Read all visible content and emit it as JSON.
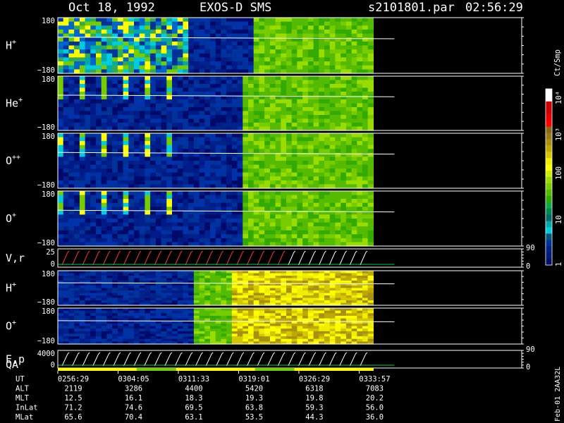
{
  "header": {
    "date": "Oct 18, 1992",
    "instrument": "EXOS-D SMS",
    "file": "s2101801.par",
    "time": "02:56:29"
  },
  "colorbar": {
    "unit": "Ct/Smp",
    "labels": [
      "10⁴",
      "10³",
      "100",
      "10",
      "1"
    ],
    "colors": [
      "#ffffff",
      "#ffffff",
      "#cc0000",
      "#cc0000",
      "#e60000",
      "#ff0000",
      "#8b6914",
      "#9b7a1c",
      "#a89010",
      "#bfa800",
      "#d4c600",
      "#eeee00",
      "#ffff00",
      "#ccee00",
      "#99dd00",
      "#77cc00",
      "#55bb00",
      "#33aa00",
      "#11aa44",
      "#008855",
      "#006666",
      "#00aaaa",
      "#00ccdd",
      "#005577",
      "#003399",
      "#002288",
      "#001a77",
      "#001166"
    ]
  },
  "chart_data": {
    "type": "heatmap",
    "panels": [
      {
        "name": "H",
        "charge": "+",
        "ymax": "180",
        "ymin": "−180",
        "palette": "mixed"
      },
      {
        "name": "He",
        "charge": "+",
        "ymax": "180",
        "ymin": "−180",
        "palette": "blue"
      },
      {
        "name": "O",
        "charge": "++",
        "ymax": "180",
        "ymin": "−180",
        "palette": "blue"
      },
      {
        "name": "O",
        "charge": "+",
        "ymax": "180",
        "ymin": "−180",
        "palette": "blue"
      },
      {
        "name": "V,r",
        "charge": "",
        "ymax": "25",
        "ymin": "0",
        "right_top": "90",
        "right_bottom": "0",
        "palette": "line"
      },
      {
        "name": "H",
        "charge": "+",
        "ymax": "180",
        "ymin": "−180",
        "palette": "yellow"
      },
      {
        "name": "O",
        "charge": "+",
        "ymax": "180",
        "ymin": "−180",
        "palette": "yellow"
      },
      {
        "name": "E,p",
        "charge": "",
        "ymax": "4000",
        "ymin": "0",
        "right_top": "90",
        "right_bottom": "0",
        "palette": "line"
      }
    ],
    "qa_label": "QA",
    "x_times": [
      "0256:29",
      "0304:05",
      "0311:33",
      "0319:01",
      "0326:29",
      "0333:57"
    ],
    "data_end_fraction": 0.68,
    "ephemeris": [
      {
        "label": "UT",
        "values": [
          "0256:29",
          "0304:05",
          "0311:33",
          "0319:01",
          "0326:29",
          "0333:57"
        ]
      },
      {
        "label": "ALT",
        "values": [
          "2119",
          "3286",
          "4400",
          "5420",
          "6318",
          "7083"
        ]
      },
      {
        "label": "MLT",
        "values": [
          "12.5",
          "16.1",
          "18.3",
          "19.3",
          "19.8",
          "20.2"
        ]
      },
      {
        "label": "InLat",
        "values": [
          "71.2",
          "74.6",
          "69.5",
          "63.8",
          "59.3",
          "56.0"
        ]
      },
      {
        "label": "MLat",
        "values": [
          "65.6",
          "70.4",
          "63.1",
          "53.5",
          "44.3",
          "36.0"
        ]
      }
    ],
    "stamp": "Feb-01 2AA32L"
  }
}
